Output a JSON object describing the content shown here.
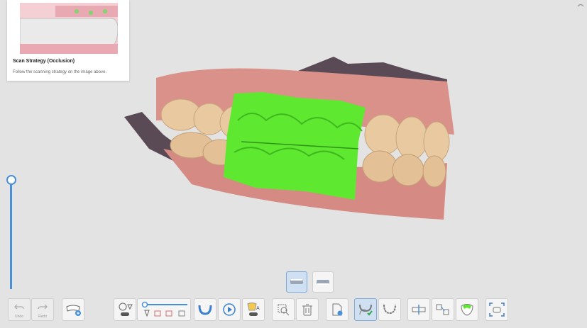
{
  "strategy": {
    "title": "Scan Strategy (Occlusion)",
    "description": "Follow the scanning strategy on the image above."
  },
  "toolbar": {
    "undo_label": "Undo",
    "redo_label": "Redo"
  },
  "colors": {
    "accent": "#4a90d9",
    "scan_highlight": "#5ee830",
    "gum": "#d9918a",
    "tooth": "#e8c9a0"
  }
}
